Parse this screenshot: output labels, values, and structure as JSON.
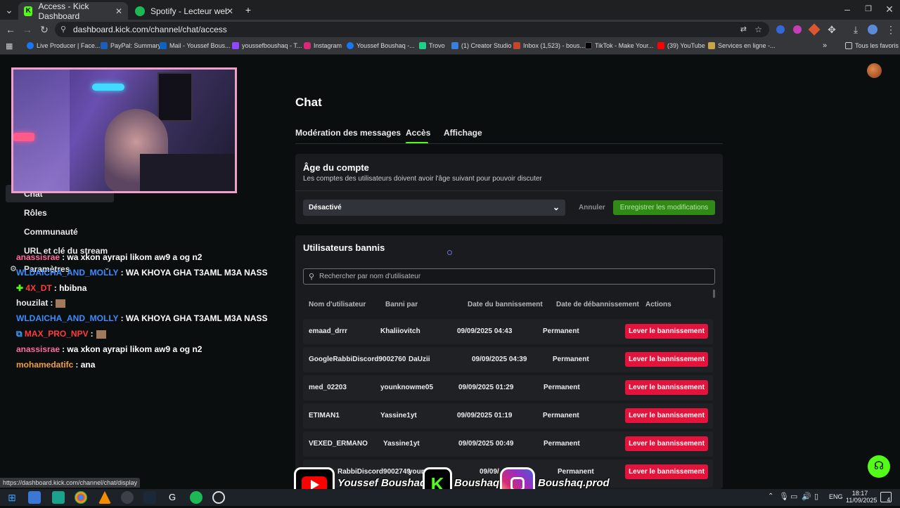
{
  "browser": {
    "tabs": [
      {
        "label": "Access - Kick Dashboard",
        "active": true
      },
      {
        "label": "Spotify - Lecteur web : de la mu",
        "active": false
      }
    ],
    "url": "dashboard.kick.com/channel/chat/access",
    "bookmarks": [
      "Live Producer | Face...",
      "PayPal: Summary",
      "Mail - Youssef Bous...",
      "youssefboushaq - T...",
      "Instagram",
      "Youssef Boushaq -...",
      "Trovo",
      "(1) Creator Studio",
      "Inbox (1,523) - bous...",
      "TikTok - Make Your...",
      "(39) YouTube",
      "Services en ligne -..."
    ],
    "all_bookmarks": "Tous les favoris",
    "status_url": "https://dashboard.kick.com/channel/chat/display"
  },
  "sidebar": {
    "items": [
      "Chat",
      "Rôles",
      "Communauté",
      "URL et clé du stream",
      "Paramètres"
    ]
  },
  "overlay_chat": [
    {
      "user": "anassisrae",
      "msg": ": wa xkon ayrapi likom aw9 a og n2",
      "color": "#ff6b9a"
    },
    {
      "user": "WLDAICHA_AND_MOLLY",
      "msg": ": WA KHOYA GHA T3AML M3A NASS",
      "color": "#3d8bff"
    },
    {
      "user": "4X_DT",
      "msg": ": hbibna",
      "color": "#ff3b3b"
    },
    {
      "user": "houzilat",
      "msg": ":",
      "color": "#e8e8e8"
    },
    {
      "user": "WLDAICHA_AND_MOLLY",
      "msg": ": WA KHOYA GHA T3AML M3A NASS",
      "color": "#3d8bff"
    },
    {
      "user": "MAX_PRO_NPV",
      "msg": ":",
      "color": "#ff3b3b"
    },
    {
      "user": "anassisrae",
      "msg": ": wa xkon ayrapi likom aw9 a og n2",
      "color": "#ff6b9a"
    },
    {
      "user": "mohamedatifc",
      "msg": ": ana",
      "color": "#f2a03d"
    }
  ],
  "main": {
    "title": "Chat",
    "tabs": [
      "Modération des messages",
      "Accès",
      "Affichage"
    ],
    "active_tab": "Accès",
    "account_age": {
      "heading": "Âge du compte",
      "description": "Les comptes des utilisateurs doivent avoir l'âge suivant pour pouvoir discuter",
      "select_value": "Désactivé",
      "cancel": "Annuler",
      "save": "Enregistrer les modifications"
    },
    "banned": {
      "heading": "Utilisateurs bannis",
      "search_placeholder": "Rechercher par nom d'utilisateur",
      "columns": [
        "Nom d'utilisateur",
        "Banni par",
        "Date du bannissement",
        "Date de débannissement",
        "Actions"
      ],
      "unban_label": "Lever le bannissement",
      "rows": [
        {
          "user": "emaad_drrr",
          "by": "Khaliiovitch",
          "date": "09/09/2025 04:43",
          "until": "Permanent"
        },
        {
          "user": "GoogleRabbiDiscord9002760",
          "by": "DaUzii",
          "date": "09/09/2025 04:39",
          "until": "Permanent"
        },
        {
          "user": "med_02203",
          "by": "younknowme05",
          "date": "09/09/2025 01:29",
          "until": "Permanent"
        },
        {
          "user": "ETIMAN1",
          "by": "Yassine1yt",
          "date": "09/09/2025 01:19",
          "until": "Permanent"
        },
        {
          "user": "VEXED_ERMANO",
          "by": "Yassine1yt",
          "date": "09/09/2025 00:49",
          "until": "Permanent"
        },
        {
          "user": "RabbiDiscord9002749",
          "by": "youn",
          "date": "09/09/",
          "until": "Permanent"
        }
      ]
    }
  },
  "stream_overlay": {
    "youtube": "Youssef Boushaq",
    "kick": "Boushaq",
    "instagram": "Boushaq.prod"
  },
  "taskbar": {
    "lang": "ENG",
    "time": "18:17",
    "date": "11/09/2025",
    "notif_count": "4"
  },
  "colors": {
    "kick_green": "#53fc18",
    "danger": "#e2143b",
    "save_green": "#2f8a16"
  }
}
